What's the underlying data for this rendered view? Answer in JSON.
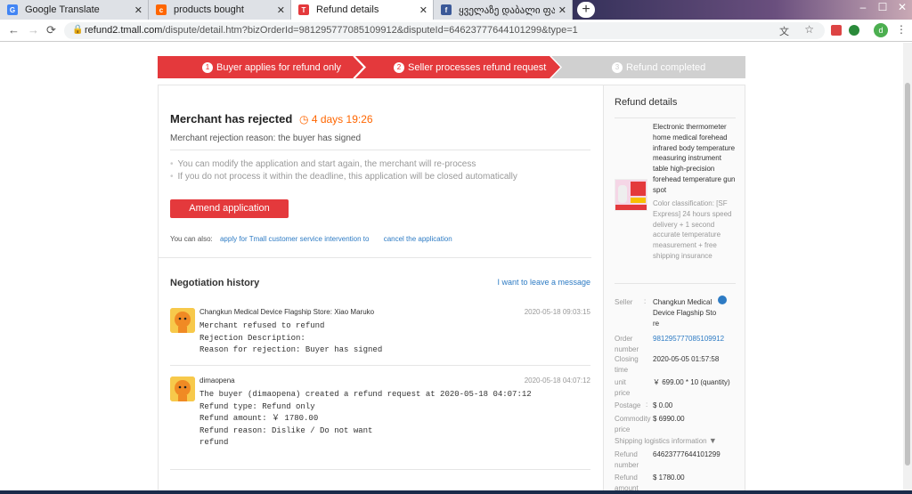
{
  "browser": {
    "tabs": [
      {
        "title": "Google Translate",
        "favicon_color": "#4285f4",
        "favicon_glyph": "G"
      },
      {
        "title": "products bought",
        "favicon_color": "#f60",
        "favicon_glyph": "c"
      },
      {
        "title": "Refund details",
        "favicon_color": "#e4393c",
        "favicon_glyph": "T"
      },
      {
        "title": "ყველაზე დაბალი ფასები, ფასდ",
        "favicon_color": "#3b5998",
        "favicon_glyph": "f"
      }
    ],
    "new_tab_label": "+",
    "window_controls": {
      "minimize": "–",
      "maximize": "☐",
      "close": "✕"
    },
    "nav": {
      "back": "←",
      "forward": "→",
      "reload": "⟳"
    },
    "url_host": "refund2.tmall.com",
    "url_path": "/dispute/detail.htm?bizOrderId=981295777085109912&disputeId=64623777644101299&type=1",
    "profile_initial": "d"
  },
  "steps": [
    {
      "num": "1",
      "label": "Buyer applies for refund only",
      "state": "done"
    },
    {
      "num": "2",
      "label": "Seller processes refund request",
      "state": "active"
    },
    {
      "num": "3",
      "label": "Refund completed",
      "state": "pending"
    }
  ],
  "status": {
    "title": "Merchant has rejected",
    "countdown": "4 days 19:26",
    "reason": "Merchant rejection reason: the buyer has signed",
    "tips": [
      "You can modify the application and start again, the merchant will re-process",
      "If you do not process it within the deadline, this application will be closed automatically"
    ],
    "amend_label": "Amend application",
    "also_label": "You can also:",
    "also_link_1": "apply for Tmall customer service intervention to",
    "also_link_2": "cancel the application"
  },
  "negotiation": {
    "title": "Negotiation history",
    "leave_message": "I want to leave a message",
    "entries": [
      {
        "who": "Changkun Medical Device Flagship Store: Xiao Maruko",
        "when": "2020-05-18 09:03:15",
        "lines": [
          "Merchant refused to refund",
          "Rejection Description:",
          "Reason for rejection: Buyer has signed"
        ]
      },
      {
        "who": "dimaopena",
        "when": "2020-05-18 04:07:12",
        "lines": [
          "The buyer (dimaopena) created a refund request at 2020-05-18 04:07:12",
          "Refund type: Refund only",
          "Refund amount: ￥ 1780.00",
          "Refund reason: Dislike / Do not want",
          "refund"
        ]
      }
    ]
  },
  "refund_details": {
    "title": "Refund details",
    "product_name": "Electronic thermometer home medical forehead infrared body temperature measuring instrument table high-precision forehead temperature gun spot",
    "product_options": "Color classification: [SF Express] 24 hours speed delivery + 1 second accurate temperature measurement + free shipping insurance",
    "seller_label": "Seller",
    "seller_value": "Changkun Medical Device Flagship Sto re",
    "order_label": "Order number",
    "order_value": "981295777085109912",
    "closing_label": "Closing time",
    "closing_value": "2020-05-05 01:57:58",
    "unit_label": "unit price",
    "unit_value": "￥ 699.00 * 10 (quantity)",
    "postage_label": "Postage",
    "postage_value": "$ 0.00",
    "commodity_label": "Commodity price",
    "commodity_value": "$ 6990.00",
    "shipping_label": "Shipping logistics information",
    "refund_no_label": "Refund number",
    "refund_no_value": "64623777644101299",
    "refund_amt_label": "Refund amount",
    "refund_amt_value": "$ 1780.00"
  },
  "colors": {
    "accent": "#e4393c",
    "link": "#2d7bc4",
    "timer": "#f60",
    "step_pending": "#d0d0d0"
  }
}
